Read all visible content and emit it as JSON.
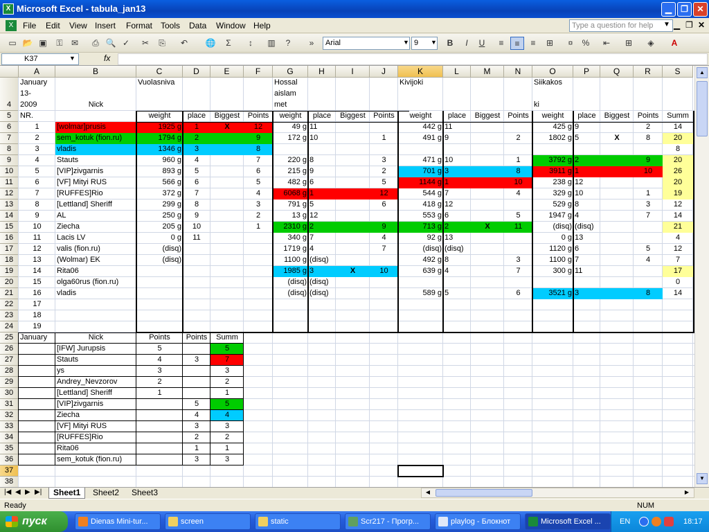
{
  "window": {
    "title": "Microsoft Excel - tabula_jan13"
  },
  "menu": [
    "File",
    "Edit",
    "View",
    "Insert",
    "Format",
    "Tools",
    "Data",
    "Window",
    "Help"
  ],
  "help_placeholder": "Type a question for help",
  "toolbar": {
    "font": "Arial",
    "size": "9"
  },
  "namebox": "K37",
  "fx": "fx",
  "colors": {
    "red": "#ff0000",
    "green": "#00cc00",
    "cyan": "#00ccff",
    "yellow": "#ffff99",
    "selection": "#c1d2ee"
  },
  "columns": [
    "A",
    "B",
    "C",
    "D",
    "E",
    "F",
    "G",
    "H",
    "I",
    "J",
    "K",
    "L",
    "M",
    "N",
    "O",
    "P",
    "Q",
    "R",
    "S"
  ],
  "rows": [
    "4",
    "5",
    "6",
    "7",
    "8",
    "9",
    "10",
    "11",
    "12",
    "13",
    "14",
    "15",
    "16",
    "17",
    "18",
    "19",
    "20",
    "21",
    "22",
    "23",
    "24",
    "25",
    "26",
    "27",
    "28",
    "29",
    "30",
    "31",
    "32",
    "33",
    "34",
    "35",
    "36",
    "37",
    "38"
  ],
  "header": {
    "date": [
      "January",
      "13-",
      "2009"
    ],
    "nick": "Nick",
    "lake1": "Vuolasniva",
    "lake2": [
      "Hossal",
      "aislam",
      "met"
    ],
    "lake3": "Kivijoki",
    "lake4": [
      "Siikakos",
      "ki"
    ]
  },
  "subheader": [
    "NR.",
    "",
    "weight",
    "place",
    "Biggest",
    "Points",
    "weight",
    "place",
    "Biggest",
    "Points",
    "weight",
    "place",
    "Biggest",
    "Points",
    "weight",
    "place",
    "Biggest",
    "Points",
    "Summ"
  ],
  "main_rows": [
    [
      "1",
      "[wolmar]prusis",
      "1925 g",
      "1",
      "X",
      "12",
      "49 g",
      "11",
      "",
      "",
      "442 g",
      "11",
      "",
      "",
      "425 g",
      "9",
      "",
      "2",
      "14"
    ],
    [
      "2",
      "sem_kotuk (fion.ru)",
      "1794 g",
      "2",
      "",
      "9",
      "172 g",
      "10",
      "",
      "1",
      "491 g",
      "9",
      "",
      "2",
      "1802 g",
      "5",
      "X",
      "8",
      "20"
    ],
    [
      "3",
      "vladis",
      "1346 g",
      "3",
      "",
      "8",
      "",
      "",
      "",
      "",
      "",
      "",
      "",
      "",
      "",
      "",
      "",
      "",
      "8"
    ],
    [
      "4",
      "Stauts",
      "960 g",
      "4",
      "",
      "7",
      "220 g",
      "8",
      "",
      "3",
      "471 g",
      "10",
      "",
      "1",
      "3792 g",
      "2",
      "",
      "9",
      "20"
    ],
    [
      "5",
      "[VIP]zivgarnis",
      "893 g",
      "5",
      "",
      "6",
      "215 g",
      "9",
      "",
      "2",
      "701 g",
      "3",
      "",
      "8",
      "3911 g",
      "1",
      "",
      "10",
      "26"
    ],
    [
      "6",
      "[VF] Mityi RUS",
      "566 g",
      "6",
      "",
      "5",
      "482 g",
      "6",
      "",
      "5",
      "1144 g",
      "1",
      "",
      "10",
      "238 g",
      "12",
      "",
      "",
      "20"
    ],
    [
      "7",
      "[RUFFES]Rio",
      "372 g",
      "7",
      "",
      "4",
      "6068 g",
      "1",
      "",
      "12",
      "544 g",
      "7",
      "",
      "4",
      "329 g",
      "10",
      "",
      "1",
      "19"
    ],
    [
      "8",
      "[Lettland] Sheriff",
      "299 g",
      "8",
      "",
      "3",
      "791 g",
      "5",
      "",
      "6",
      "418 g",
      "12",
      "",
      "",
      "529 g",
      "8",
      "",
      "3",
      "12"
    ],
    [
      "9",
      "AL",
      "250 g",
      "9",
      "",
      "2",
      "13 g",
      "12",
      "",
      "",
      "553 g",
      "6",
      "",
      "5",
      "1947 g",
      "4",
      "",
      "7",
      "14"
    ],
    [
      "10",
      "Ziecha",
      "205 g",
      "10",
      "",
      "1",
      "2310 g",
      "2",
      "",
      "9",
      "713 g",
      "2",
      "X",
      "11",
      "(disq)",
      "(disq)",
      "",
      "",
      "21"
    ],
    [
      "11",
      "Lacis LV",
      "0 g",
      "11",
      "",
      "",
      "340 g",
      "7",
      "",
      "4",
      "92 g",
      "13",
      "",
      "",
      "0 g",
      "13",
      "",
      "",
      "4"
    ],
    [
      "12",
      "valis (fion.ru)",
      "(disq)",
      "",
      "",
      "",
      "1719 g",
      "4",
      "",
      "7",
      "(disq)",
      "(disq)",
      "",
      "",
      "1120 g",
      "6",
      "",
      "5",
      "12"
    ],
    [
      "13",
      "(Wolmar) EK",
      "(disq)",
      "",
      "",
      "",
      "1100 g",
      "(disq)",
      "",
      "",
      "492 g",
      "8",
      "",
      "3",
      "1100 g",
      "7",
      "",
      "4",
      "7"
    ],
    [
      "14",
      "Rita06",
      "",
      "",
      "",
      "",
      "1985 g",
      "3",
      "X",
      "10",
      "639 g",
      "4",
      "",
      "7",
      "300 g",
      "11",
      "",
      "",
      "17"
    ],
    [
      "15",
      "olga60rus (fion.ru)",
      "",
      "",
      "",
      "",
      "(disq)",
      "(disq)",
      "",
      "",
      "",
      "",
      "",
      "",
      "",
      "",
      "",
      "",
      "0"
    ],
    [
      "16",
      "vladis",
      "",
      "",
      "",
      "",
      "(disq)",
      "(disq)",
      "",
      "",
      "589 g",
      "5",
      "",
      "6",
      "3521 g",
      "3",
      "",
      "8",
      "14"
    ],
    [
      "17",
      "",
      "",
      "",
      "",
      "",
      "",
      "",
      "",
      "",
      "",
      "",
      "",
      "",
      "",
      "",
      "",
      "",
      ""
    ],
    [
      "18",
      "",
      "",
      "",
      "",
      "",
      "",
      "",
      "",
      "",
      "",
      "",
      "",
      "",
      "",
      "",
      "",
      "",
      ""
    ],
    [
      "19",
      "",
      "",
      "",
      "",
      "",
      "",
      "",
      "",
      "",
      "",
      "",
      "",
      "",
      "",
      "",
      "",
      "",
      ""
    ]
  ],
  "summary_header": [
    "January",
    "Nick",
    "Points",
    "Points",
    "Summ"
  ],
  "summary_rows": [
    [
      "[IFW] Jurupsis",
      "5",
      "",
      "5"
    ],
    [
      "Stauts",
      "4",
      "3",
      "7"
    ],
    [
      "ys",
      "3",
      "",
      "3"
    ],
    [
      "Andrey_Nevzorov",
      "2",
      "",
      "2"
    ],
    [
      "[Lettland] Sheriff",
      "1",
      "",
      "1"
    ],
    [
      "[VIP]zivgarnis",
      "",
      "5",
      "5"
    ],
    [
      "Ziecha",
      "",
      "4",
      "4"
    ],
    [
      "[VF] Mityi RUS",
      "",
      "3",
      "3"
    ],
    [
      "[RUFFES]Rio",
      "",
      "2",
      "2"
    ],
    [
      "Rita06",
      "",
      "1",
      "1"
    ],
    [
      "sem_kotuk (fion.ru)",
      "",
      "3",
      "3"
    ]
  ],
  "sheets": [
    "Sheet1",
    "Sheet2",
    "Sheet3"
  ],
  "status": {
    "left": "Ready",
    "right": "NUM"
  },
  "taskbar": {
    "start": "пуск",
    "items": [
      "Dienas Mini-tur...",
      "screen",
      "static",
      "Scr217 - Прогр...",
      "playlog - Блокнот",
      "Microsoft Excel ..."
    ],
    "lang": "EN",
    "clock": "18:17"
  }
}
